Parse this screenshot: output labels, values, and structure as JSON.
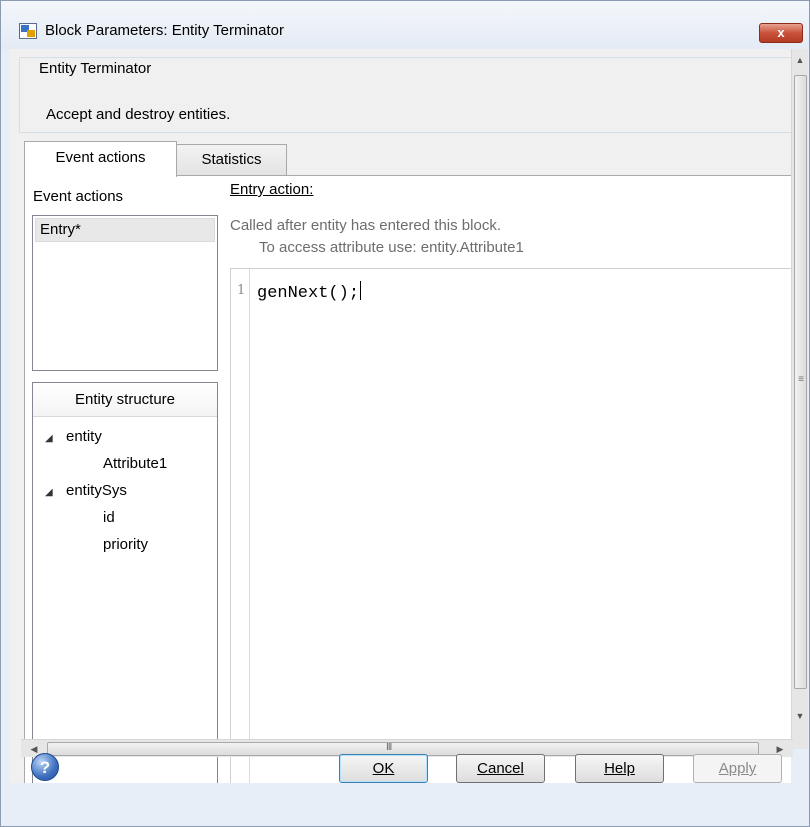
{
  "window": {
    "title": "Block Parameters: Entity Terminator",
    "close_glyph": "x",
    "icon": "simulink-block-icon"
  },
  "description": {
    "group_title": "Entity Terminator",
    "text": "Accept and destroy entities."
  },
  "tabs": [
    {
      "label": "Event actions",
      "active": true
    },
    {
      "label": "Statistics",
      "active": false
    }
  ],
  "event_actions": {
    "label": "Event actions",
    "items": [
      "Entry*"
    ],
    "selected": "Entry*"
  },
  "entity_structure": {
    "header": "Entity structure",
    "tree": [
      {
        "label": "entity",
        "children": [
          "Attribute1"
        ]
      },
      {
        "label": "entitySys",
        "children": [
          "id",
          "priority"
        ]
      }
    ]
  },
  "entry_action": {
    "label": "Entry action:",
    "hint_line1": "Called after entity has entered this block.",
    "hint_line2": "To access attribute use: entity.Attribute1",
    "line_number": "1",
    "code": "genNext();"
  },
  "scrollbars": {
    "h_grip": "III",
    "v_grip": "≡"
  },
  "buttons": {
    "help_icon_glyph": "?",
    "ok": "OK",
    "cancel": "Cancel",
    "help": "Help",
    "apply": "Apply"
  },
  "colors": {
    "close_button": "#c9523a",
    "help_icon": "#3d6fbf",
    "default_button_border": "#3c7fb1"
  }
}
